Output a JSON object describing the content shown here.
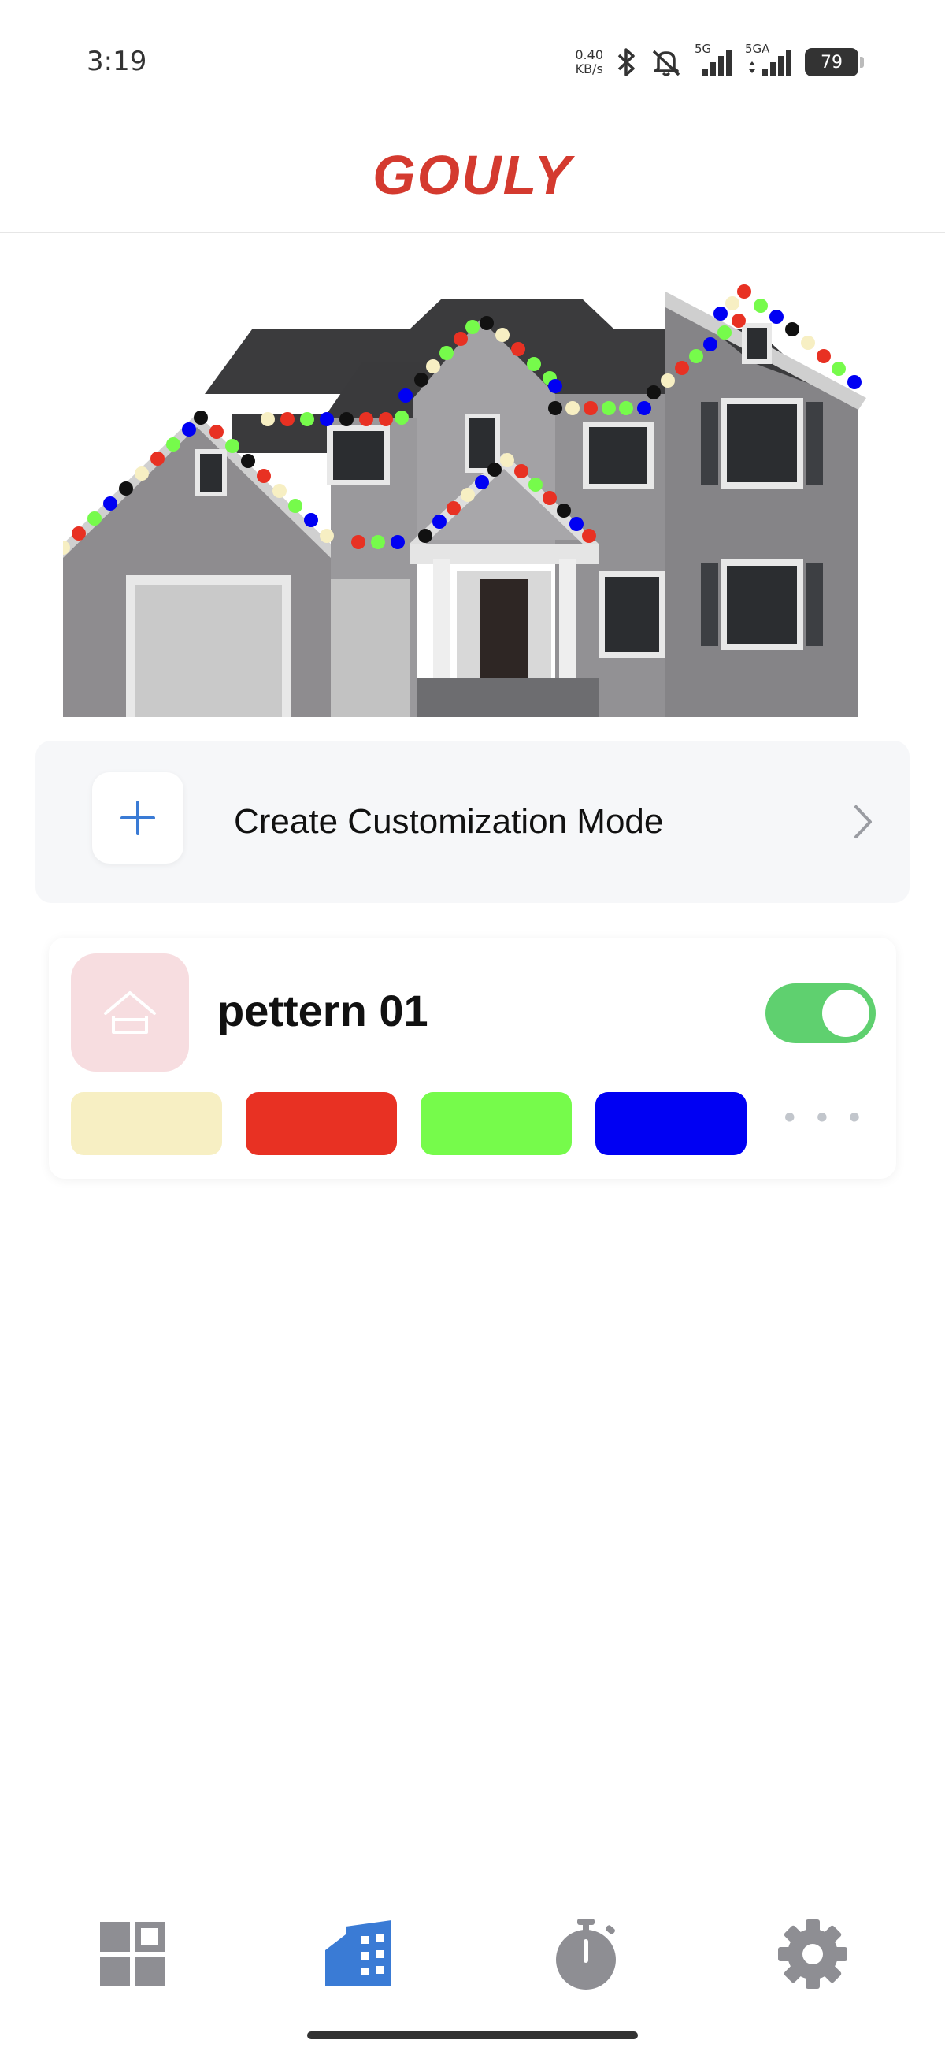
{
  "status_bar": {
    "time": "3:19",
    "net_speed_value": "0.40",
    "net_speed_unit": "KB/s",
    "signal1_label": "5G",
    "signal2_label": "5GA",
    "battery": "79",
    "icons": [
      "bluetooth-icon",
      "mute-icon",
      "signal-icon",
      "signal-icon"
    ]
  },
  "header": {
    "brand": "GOULY",
    "brand_color": "#d43a2f"
  },
  "create_card": {
    "label": "Create Customization Mode",
    "icon": "plus-icon",
    "accent": "#3a7bd5"
  },
  "pattern": {
    "name": "pettern 01",
    "enabled": true,
    "toggle_color": "#5fd06f",
    "swatches": [
      "#f7efc3",
      "#e83123",
      "#76fb4b",
      "#0000f3"
    ],
    "more": "• • •"
  },
  "nav": {
    "items": [
      {
        "icon": "dashboard-icon",
        "active": false
      },
      {
        "icon": "building-icon",
        "active": true
      },
      {
        "icon": "timer-icon",
        "active": false
      },
      {
        "icon": "settings-icon",
        "active": false
      }
    ],
    "active_color": "#3a7bd5",
    "inactive_color": "#8e8e93"
  }
}
